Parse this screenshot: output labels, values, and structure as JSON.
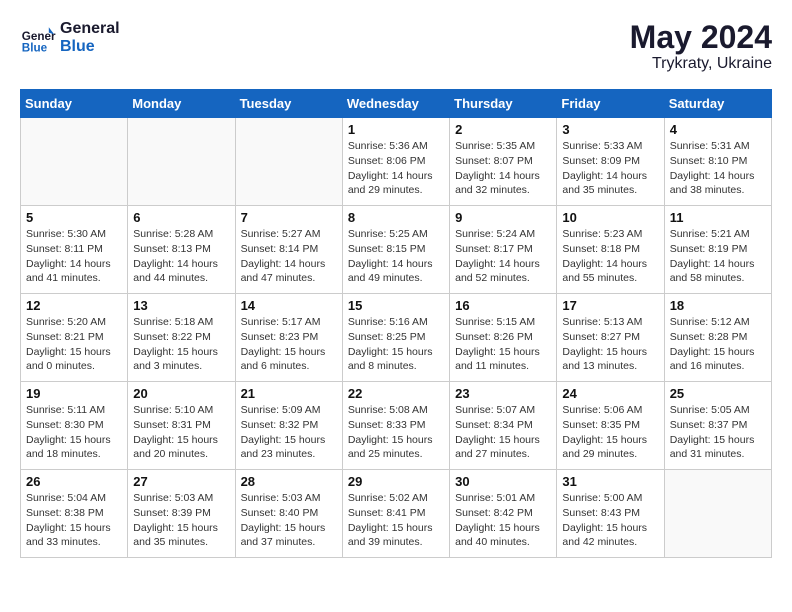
{
  "header": {
    "logo_line1": "General",
    "logo_line2": "Blue",
    "month_year": "May 2024",
    "location": "Trykraty, Ukraine"
  },
  "weekdays": [
    "Sunday",
    "Monday",
    "Tuesday",
    "Wednesday",
    "Thursday",
    "Friday",
    "Saturday"
  ],
  "weeks": [
    [
      {
        "day": "",
        "info": ""
      },
      {
        "day": "",
        "info": ""
      },
      {
        "day": "",
        "info": ""
      },
      {
        "day": "1",
        "info": "Sunrise: 5:36 AM\nSunset: 8:06 PM\nDaylight: 14 hours\nand 29 minutes."
      },
      {
        "day": "2",
        "info": "Sunrise: 5:35 AM\nSunset: 8:07 PM\nDaylight: 14 hours\nand 32 minutes."
      },
      {
        "day": "3",
        "info": "Sunrise: 5:33 AM\nSunset: 8:09 PM\nDaylight: 14 hours\nand 35 minutes."
      },
      {
        "day": "4",
        "info": "Sunrise: 5:31 AM\nSunset: 8:10 PM\nDaylight: 14 hours\nand 38 minutes."
      }
    ],
    [
      {
        "day": "5",
        "info": "Sunrise: 5:30 AM\nSunset: 8:11 PM\nDaylight: 14 hours\nand 41 minutes."
      },
      {
        "day": "6",
        "info": "Sunrise: 5:28 AM\nSunset: 8:13 PM\nDaylight: 14 hours\nand 44 minutes."
      },
      {
        "day": "7",
        "info": "Sunrise: 5:27 AM\nSunset: 8:14 PM\nDaylight: 14 hours\nand 47 minutes."
      },
      {
        "day": "8",
        "info": "Sunrise: 5:25 AM\nSunset: 8:15 PM\nDaylight: 14 hours\nand 49 minutes."
      },
      {
        "day": "9",
        "info": "Sunrise: 5:24 AM\nSunset: 8:17 PM\nDaylight: 14 hours\nand 52 minutes."
      },
      {
        "day": "10",
        "info": "Sunrise: 5:23 AM\nSunset: 8:18 PM\nDaylight: 14 hours\nand 55 minutes."
      },
      {
        "day": "11",
        "info": "Sunrise: 5:21 AM\nSunset: 8:19 PM\nDaylight: 14 hours\nand 58 minutes."
      }
    ],
    [
      {
        "day": "12",
        "info": "Sunrise: 5:20 AM\nSunset: 8:21 PM\nDaylight: 15 hours\nand 0 minutes."
      },
      {
        "day": "13",
        "info": "Sunrise: 5:18 AM\nSunset: 8:22 PM\nDaylight: 15 hours\nand 3 minutes."
      },
      {
        "day": "14",
        "info": "Sunrise: 5:17 AM\nSunset: 8:23 PM\nDaylight: 15 hours\nand 6 minutes."
      },
      {
        "day": "15",
        "info": "Sunrise: 5:16 AM\nSunset: 8:25 PM\nDaylight: 15 hours\nand 8 minutes."
      },
      {
        "day": "16",
        "info": "Sunrise: 5:15 AM\nSunset: 8:26 PM\nDaylight: 15 hours\nand 11 minutes."
      },
      {
        "day": "17",
        "info": "Sunrise: 5:13 AM\nSunset: 8:27 PM\nDaylight: 15 hours\nand 13 minutes."
      },
      {
        "day": "18",
        "info": "Sunrise: 5:12 AM\nSunset: 8:28 PM\nDaylight: 15 hours\nand 16 minutes."
      }
    ],
    [
      {
        "day": "19",
        "info": "Sunrise: 5:11 AM\nSunset: 8:30 PM\nDaylight: 15 hours\nand 18 minutes."
      },
      {
        "day": "20",
        "info": "Sunrise: 5:10 AM\nSunset: 8:31 PM\nDaylight: 15 hours\nand 20 minutes."
      },
      {
        "day": "21",
        "info": "Sunrise: 5:09 AM\nSunset: 8:32 PM\nDaylight: 15 hours\nand 23 minutes."
      },
      {
        "day": "22",
        "info": "Sunrise: 5:08 AM\nSunset: 8:33 PM\nDaylight: 15 hours\nand 25 minutes."
      },
      {
        "day": "23",
        "info": "Sunrise: 5:07 AM\nSunset: 8:34 PM\nDaylight: 15 hours\nand 27 minutes."
      },
      {
        "day": "24",
        "info": "Sunrise: 5:06 AM\nSunset: 8:35 PM\nDaylight: 15 hours\nand 29 minutes."
      },
      {
        "day": "25",
        "info": "Sunrise: 5:05 AM\nSunset: 8:37 PM\nDaylight: 15 hours\nand 31 minutes."
      }
    ],
    [
      {
        "day": "26",
        "info": "Sunrise: 5:04 AM\nSunset: 8:38 PM\nDaylight: 15 hours\nand 33 minutes."
      },
      {
        "day": "27",
        "info": "Sunrise: 5:03 AM\nSunset: 8:39 PM\nDaylight: 15 hours\nand 35 minutes."
      },
      {
        "day": "28",
        "info": "Sunrise: 5:03 AM\nSunset: 8:40 PM\nDaylight: 15 hours\nand 37 minutes."
      },
      {
        "day": "29",
        "info": "Sunrise: 5:02 AM\nSunset: 8:41 PM\nDaylight: 15 hours\nand 39 minutes."
      },
      {
        "day": "30",
        "info": "Sunrise: 5:01 AM\nSunset: 8:42 PM\nDaylight: 15 hours\nand 40 minutes."
      },
      {
        "day": "31",
        "info": "Sunrise: 5:00 AM\nSunset: 8:43 PM\nDaylight: 15 hours\nand 42 minutes."
      },
      {
        "day": "",
        "info": ""
      }
    ]
  ]
}
